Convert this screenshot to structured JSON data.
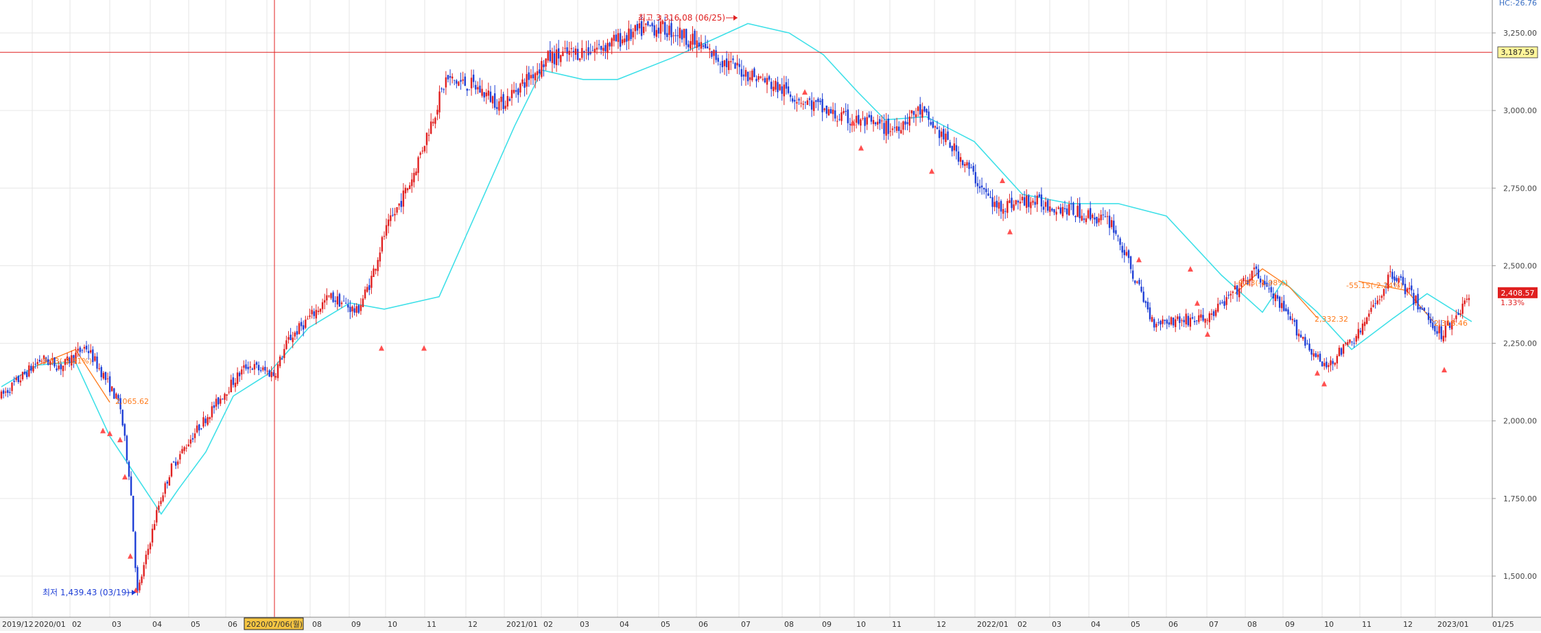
{
  "chart_data": {
    "type": "candlestick",
    "title": "",
    "xlabel": "",
    "ylabel": "",
    "ylim": [
      1439.43,
      3316.08
    ],
    "grid": true,
    "y_ticks": [
      "3,250.00",
      "3,000.00",
      "2,750.00",
      "2,500.00",
      "2,250.00",
      "2,000.00",
      "1,750.00",
      "1,500.00"
    ],
    "y_tick_values": [
      3250,
      3000,
      2750,
      2500,
      2250,
      2000,
      1750,
      1500
    ],
    "x_ticks": [
      "2019/12",
      "2020/01",
      "02",
      "03",
      "04",
      "05",
      "06",
      "2020/07/06(월)",
      "08",
      "09",
      "10",
      "11",
      "12",
      "2021/01",
      "02",
      "03",
      "04",
      "05",
      "06",
      "07",
      "08",
      "09",
      "10",
      "11",
      "12",
      "2022/01",
      "02",
      "03",
      "04",
      "05",
      "06",
      "07",
      "08",
      "09",
      "10",
      "11",
      "12",
      "2023/01",
      "01/25"
    ],
    "top_right_label": "HC:-26.76",
    "crosshair": {
      "date": "2020/07/06(월)",
      "price_label": "3,187.59",
      "price": 3187.59
    },
    "last_price": {
      "label": "2,408.57",
      "change": "1.33%",
      "value": 2408.57
    },
    "annotations": {
      "high": "최고 3,316.08 (06/25)",
      "low": "최저 1,439.43 (03/19)",
      "labels": [
        "-3.33(-3.81%)",
        "2,065.62",
        "-9.83(-1.98%)",
        "2,332.32",
        "-55.15(-2.24%)",
        "2,318.46"
      ]
    },
    "series": [
      {
        "name": "",
        "type": "candlestick",
        "close_path": [
          [
            "2019/12",
            2080
          ],
          [
            "2020/01",
            2200
          ],
          [
            "2020/01",
            2175
          ],
          [
            "02",
            2240
          ],
          [
            "02",
            2150
          ],
          [
            "03",
            2050
          ],
          [
            "03",
            1800
          ],
          [
            "03",
            1439
          ],
          [
            "04",
            1720
          ],
          [
            "04",
            1850
          ],
          [
            "05",
            1950
          ],
          [
            "06",
            2100
          ],
          [
            "06",
            2180
          ],
          [
            "07",
            2150
          ],
          [
            "07",
            2260
          ],
          [
            "08",
            2400
          ],
          [
            "09",
            2380
          ],
          [
            "10",
            2350
          ],
          [
            "11",
            2450
          ],
          [
            "11",
            2600
          ],
          [
            "12",
            2780
          ],
          [
            "2021/01",
            3100
          ],
          [
            "02",
            3080
          ],
          [
            "03",
            3020
          ],
          [
            "04",
            3170
          ],
          [
            "05",
            3200
          ],
          [
            "06",
            3270
          ],
          [
            "07",
            3250
          ],
          [
            "08",
            3150
          ],
          [
            "09",
            3100
          ],
          [
            "10",
            2980
          ],
          [
            "11",
            2940
          ],
          [
            "12",
            3000
          ],
          [
            "2022/01",
            2850
          ],
          [
            "02",
            2690
          ],
          [
            "03",
            2710
          ],
          [
            "04",
            2680
          ],
          [
            "05",
            2640
          ],
          [
            "06",
            2320
          ],
          [
            "07",
            2330
          ],
          [
            "08",
            2480
          ],
          [
            "09",
            2170
          ],
          [
            "10",
            2280
          ],
          [
            "11",
            2480
          ],
          [
            "12",
            2280
          ],
          [
            "2023/01",
            2408.57
          ]
        ]
      },
      {
        "name": "",
        "type": "moving-average",
        "values": [
          [
            "2019/12",
            2110
          ],
          [
            "2020/01",
            2180
          ],
          [
            "02",
            2190
          ],
          [
            "03",
            1950
          ],
          [
            "03",
            1700
          ],
          [
            "04",
            1780
          ],
          [
            "05",
            1900
          ],
          [
            "06",
            2080
          ],
          [
            "07",
            2150
          ],
          [
            "08",
            2300
          ],
          [
            "09",
            2380
          ],
          [
            "10",
            2360
          ],
          [
            "11",
            2400
          ],
          [
            "12",
            2700
          ],
          [
            "2021/01",
            2950
          ],
          [
            "02",
            3130
          ],
          [
            "03",
            3100
          ],
          [
            "04",
            3100
          ],
          [
            "05",
            3170
          ],
          [
            "06",
            3230
          ],
          [
            "07",
            3280
          ],
          [
            "08",
            3250
          ],
          [
            "09",
            3180
          ],
          [
            "10",
            3060
          ],
          [
            "11",
            2970
          ],
          [
            "12",
            2980
          ],
          [
            "2022/01",
            2900
          ],
          [
            "02",
            2730
          ],
          [
            "03",
            2700
          ],
          [
            "04",
            2700
          ],
          [
            "05",
            2660
          ],
          [
            "06",
            2470
          ],
          [
            "07",
            2350
          ],
          [
            "08",
            2450
          ],
          [
            "09",
            2350
          ],
          [
            "10",
            2230
          ],
          [
            "11",
            2330
          ],
          [
            "12",
            2410
          ],
          [
            "2023/01",
            2320
          ]
        ]
      }
    ]
  }
}
